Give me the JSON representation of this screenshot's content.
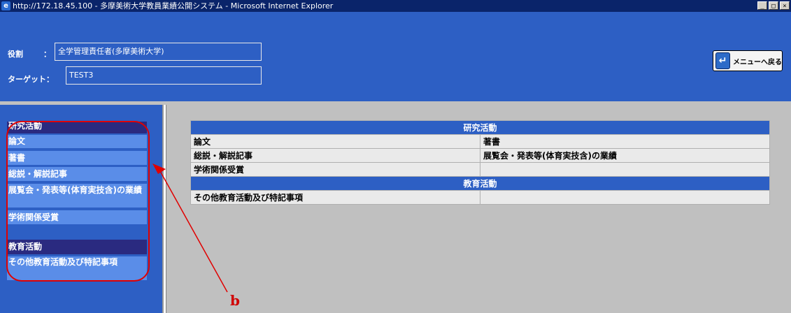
{
  "window": {
    "title": "http://172.18.45.100 - 多摩美術大学教員業績公開システム - Microsoft Internet Explorer",
    "buttons": [
      "_",
      "□",
      "×"
    ]
  },
  "header": {
    "role_label": "役割",
    "role_colon": "：",
    "role_value": "全学管理責任者(多摩美術大学)",
    "target_label": "ターゲット：",
    "target_value": "TEST3",
    "menu_button": "メニューへ戻る"
  },
  "sidebar": {
    "research_heading": "研究活動",
    "research_items": [
      "論文",
      "著書",
      "総説・解説記事",
      "展覧会・発表等(体育実技含)の業績",
      "学術関係受賞"
    ],
    "education_heading": "教育活動",
    "education_items": [
      "その他教育活動及び特記事項"
    ]
  },
  "main": {
    "research_heading": "研究活動",
    "rows": [
      [
        "論文",
        "著書"
      ],
      [
        "総説・解説記事",
        "展覧会・発表等(体育実技含)の業績"
      ],
      [
        "学術関係受賞",
        ""
      ]
    ],
    "education_heading": "教育活動",
    "education_rows": [
      [
        "その他教育活動及び特記事項",
        ""
      ]
    ]
  },
  "annotation": {
    "label": "b",
    "color": "#e00000"
  },
  "colors": {
    "header_bg": "#2d5fc4",
    "titlebar_bg": "#0a246a",
    "content_bg": "#c0c0c0",
    "link_bg": "#5a8de8",
    "heading_bg": "#2a2a80"
  }
}
